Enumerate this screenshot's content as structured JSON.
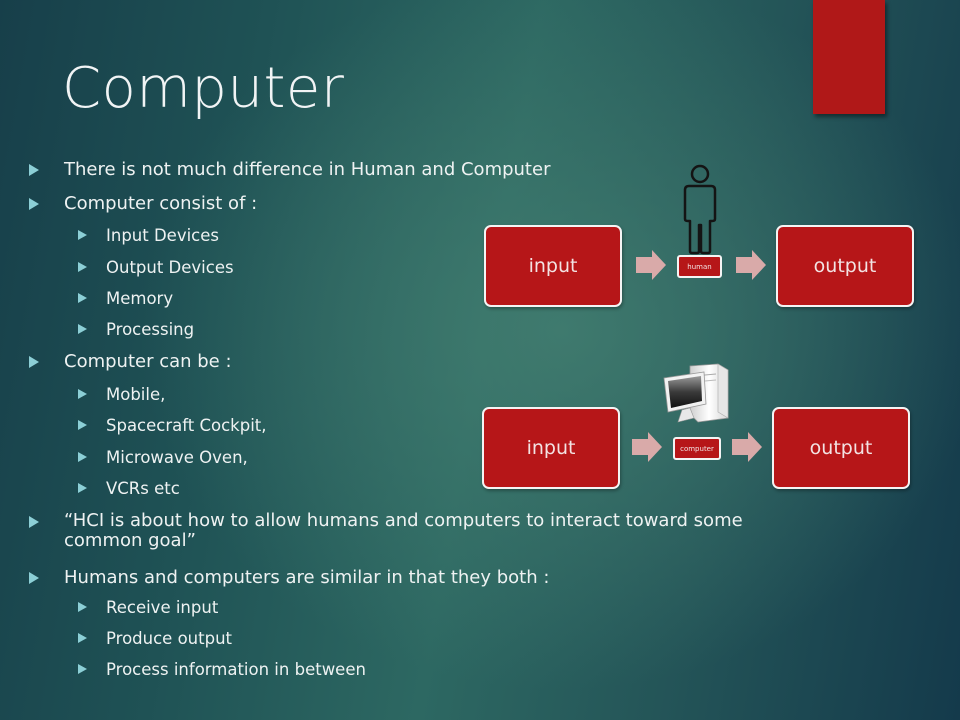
{
  "slide": {
    "title": "Computer",
    "accent_color": "#b01818",
    "bullets": [
      {
        "level": 1,
        "text": "There is not much difference in Human and Computer"
      },
      {
        "level": 1,
        "text": "Computer consist of :"
      },
      {
        "level": 2,
        "text": "Input Devices"
      },
      {
        "level": 2,
        "text": "Output Devices"
      },
      {
        "level": 2,
        "text": "Memory"
      },
      {
        "level": 2,
        "text": "Processing"
      },
      {
        "level": 1,
        "text": "Computer can be :"
      },
      {
        "level": 2,
        "text": "Mobile,"
      },
      {
        "level": 2,
        "text": "Spacecraft Cockpit,"
      },
      {
        "level": 2,
        "text": "Microwave Oven,"
      },
      {
        "level": 2,
        "text": "VCRs etc"
      },
      {
        "level": 1,
        "text": "“HCI is about how to allow humans and computers to interact toward some common goal”"
      },
      {
        "level": 1,
        "text": "Humans and computers are similar in that they both :"
      },
      {
        "level": 2,
        "text": "Receive input"
      },
      {
        "level": 2,
        "text": "Produce output"
      },
      {
        "level": 2,
        "text": "Process information in between"
      }
    ]
  },
  "diagrams": {
    "human_flow": {
      "input_label": "input",
      "processor_label": "human",
      "processor_icon": "person-icon",
      "output_label": "output"
    },
    "computer_flow": {
      "input_label": "input",
      "processor_label": "computer",
      "processor_icon": "desktop-computer-icon",
      "output_label": "output"
    },
    "box_color": "#b61618",
    "arrow_color": "#d9aaa9"
  }
}
